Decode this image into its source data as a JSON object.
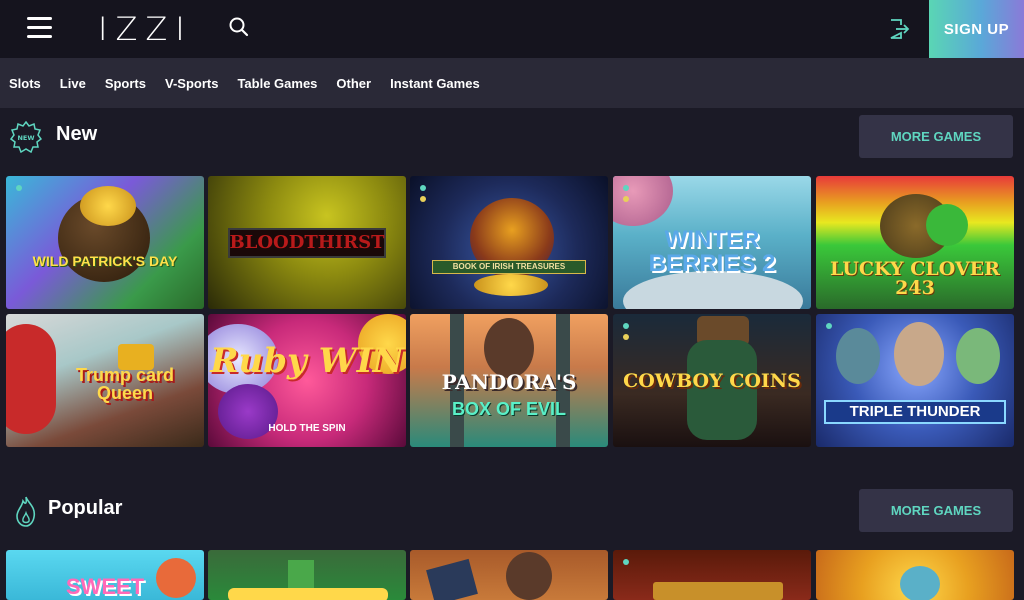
{
  "header": {
    "logo": "IZZI",
    "signup_label": "SIGN UP",
    "icons": [
      "menu-icon",
      "search-icon",
      "login-icon"
    ]
  },
  "nav": {
    "items": [
      "Slots",
      "Live",
      "Sports",
      "V-Sports",
      "Table Games",
      "Other",
      "Instant Games"
    ]
  },
  "sections": [
    {
      "title": "New",
      "icon": "new-badge-icon",
      "more_label": "MORE GAMES",
      "games": [
        {
          "title": "WILD PATRICK'S DAY",
          "color": "#5a9a3a"
        },
        {
          "title": "BLOODTHIRST",
          "color": "#8c8a10"
        },
        {
          "title": "BOOK OF IRISH TREASURES",
          "color": "#1d2a5a"
        },
        {
          "title": "WINTER BERRIES 2",
          "color": "#5ab0c8"
        },
        {
          "title": "LUCKY CLOVER 243",
          "color": "#3a8a2a"
        },
        {
          "title": "Trump card Queen",
          "color": "#b84a3a"
        },
        {
          "title": "Ruby WIN",
          "subtitle": "HOLD THE SPIN",
          "color": "#c82a7a"
        },
        {
          "title": "PANDORA'S",
          "subtitle": "BOX OF EVIL",
          "color": "#c87a4a"
        },
        {
          "title": "COWBOY COINS",
          "color": "#3a2a22"
        },
        {
          "title": "TRIPLE THUNDER",
          "color": "#3a5ab8"
        }
      ]
    },
    {
      "title": "Popular",
      "icon": "flame-icon",
      "more_label": "MORE GAMES",
      "games": [
        {
          "title": "SWEET",
          "color": "#3ab8d8"
        },
        {
          "title": "",
          "color": "#2a8a3a"
        },
        {
          "title": "",
          "color": "#c87a3a"
        },
        {
          "title": "",
          "color": "#8a2a1a"
        },
        {
          "title": "",
          "color": "#e8a020"
        }
      ]
    }
  ]
}
